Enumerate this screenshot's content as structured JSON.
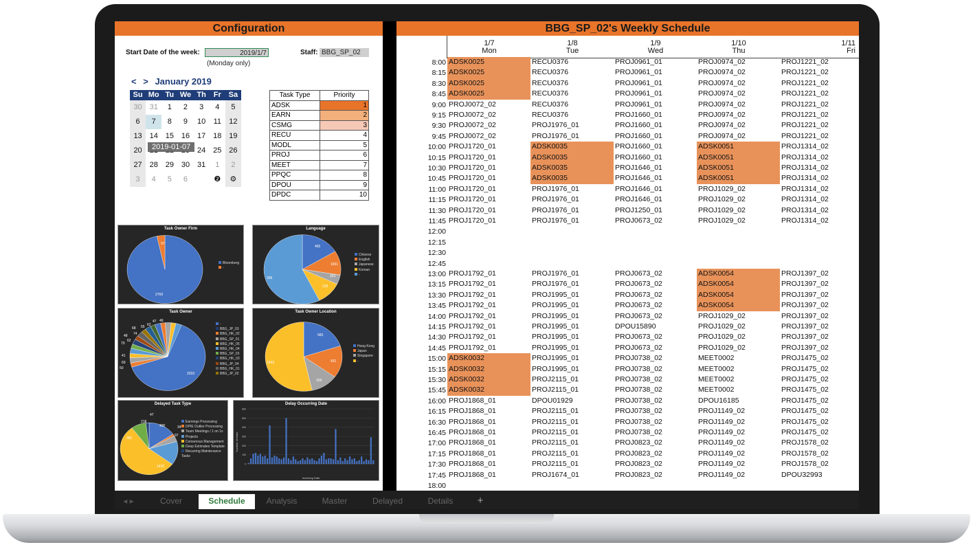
{
  "config": {
    "title": "Configuration",
    "start_label": "Start Date of the week:",
    "start_value": "2019/1/7",
    "monday_note": "(Monday only)",
    "staff_label": "Staff:",
    "staff_value": "BBG_SP_02",
    "calendar": {
      "prev": "<",
      "next": ">",
      "month": "January 2019",
      "dow": [
        "Su",
        "Mo",
        "Tu",
        "We",
        "Th",
        "Fr",
        "Sa"
      ],
      "tooltip": "2019-01-07"
    },
    "task_table": {
      "headers": [
        "Task Type",
        "Priority"
      ],
      "rows": [
        {
          "type": "ADSK",
          "priority": "1"
        },
        {
          "type": "EARN",
          "priority": "2"
        },
        {
          "type": "CSMG",
          "priority": "3"
        },
        {
          "type": "RECU",
          "priority": "4"
        },
        {
          "type": "MODL",
          "priority": "5"
        },
        {
          "type": "PROJ",
          "priority": "6"
        },
        {
          "type": "MEET",
          "priority": "7"
        },
        {
          "type": "PPQC",
          "priority": "8"
        },
        {
          "type": "DPOU",
          "priority": "9"
        },
        {
          "type": "DPDC",
          "priority": "10"
        }
      ]
    }
  },
  "charts": {
    "owner_firm": {
      "title": "Task Owner Firm",
      "labels": [
        "2769",
        "97"
      ],
      "legend": [
        "Bloomberg",
        "-"
      ]
    },
    "language": {
      "title": "Language",
      "labels": [
        "465",
        "1651",
        "323",
        "126",
        "306"
      ],
      "legend": [
        "Chinese",
        "English",
        "Japanese",
        "Korean",
        "-"
      ]
    },
    "task_owner": {
      "title": "Task Owner",
      "labels": [
        "2033",
        "68",
        "48",
        "74",
        "55",
        "62",
        "47",
        "49",
        "70",
        "62",
        "41",
        "69",
        "50"
      ],
      "legend": [
        "-",
        "BBG_JP_03",
        "BBG_HK_02",
        "BBG_SP_01",
        "BBG_HK_05",
        "BBG_HK_04",
        "BBG_SP_03",
        "BBG_HK_03",
        "BBG_JP_04",
        "BBG_HK_01",
        "BBG_JP_02"
      ]
    },
    "owner_location": {
      "title": "Task Owner Location",
      "labels": [
        "583",
        "431",
        "329",
        "1543"
      ],
      "legend": [
        "Hong Kong",
        "Japan",
        "Singapore",
        "-"
      ]
    },
    "delayed_type": {
      "title": "Delayed Task Type",
      "labels": [
        "400",
        "34",
        "97",
        "381",
        "1410",
        "218",
        "47"
      ],
      "legend": [
        "Earnings Processing",
        "DPIE Outlier Processing",
        "Team Meetings / 1 on 1s",
        "Projects",
        "Consensus Management",
        "Deep Estimates Template",
        "Recurring Maintenance Tasks"
      ]
    },
    "delay_date": {
      "title": "Delay Occurring Date",
      "xlabel": "Incoming Date",
      "ylabel": "Number of tasks",
      "yticks": [
        "600",
        "500",
        "400",
        "300",
        "200",
        "100",
        "0"
      ]
    }
  },
  "schedule": {
    "title": "BBG_SP_02's Weekly Schedule",
    "days": [
      {
        "date": "1/7",
        "dow": "Mon"
      },
      {
        "date": "1/8",
        "dow": "Tue"
      },
      {
        "date": "1/9",
        "dow": "Wed"
      },
      {
        "date": "1/10",
        "dow": "Thu"
      },
      {
        "date": "1/11",
        "dow": "Fri"
      }
    ],
    "rows": [
      {
        "t": "8:00",
        "c": [
          "ADSK0025*",
          "RECU0376",
          "PROJ0961_01",
          "PROJ0974_02",
          "PROJ1221_02"
        ]
      },
      {
        "t": "8:15",
        "c": [
          "ADSK0025*",
          "RECU0376",
          "PROJ0961_01",
          "PROJ0974_02",
          "PROJ1221_02"
        ]
      },
      {
        "t": "8:30",
        "c": [
          "ADSK0025*",
          "RECU0376",
          "PROJ0961_01",
          "PROJ0974_02",
          "PROJ1221_02"
        ]
      },
      {
        "t": "8:45",
        "c": [
          "ADSK0025*",
          "RECU0376",
          "PROJ0961_01",
          "PROJ0974_02",
          "PROJ1221_02"
        ]
      },
      {
        "t": "9:00",
        "c": [
          "PROJ0072_02",
          "RECU0376",
          "PROJ0961_01",
          "PROJ0974_02",
          "PROJ1221_02"
        ]
      },
      {
        "t": "9:15",
        "c": [
          "PROJ0072_02",
          "RECU0376",
          "PROJ1660_01",
          "PROJ0974_02",
          "PROJ1221_02"
        ]
      },
      {
        "t": "9:30",
        "c": [
          "PROJ0072_02",
          "PROJ1976_01",
          "PROJ1660_01",
          "PROJ0974_02",
          "PROJ1221_02"
        ]
      },
      {
        "t": "9:45",
        "c": [
          "PROJ0072_02",
          "PROJ1976_01",
          "PROJ1660_01",
          "PROJ0974_02",
          "PROJ1221_02"
        ]
      },
      {
        "t": "10:00",
        "c": [
          "PROJ1720_01",
          "ADSK0035*",
          "PROJ1660_01",
          "ADSK0051*",
          "PROJ1314_02"
        ]
      },
      {
        "t": "10:15",
        "c": [
          "PROJ1720_01",
          "ADSK0035*",
          "PROJ1660_01",
          "ADSK0051*",
          "PROJ1314_02"
        ]
      },
      {
        "t": "10:30",
        "c": [
          "PROJ1720_01",
          "ADSK0035*",
          "PROJ1646_01",
          "ADSK0051*",
          "PROJ1314_02"
        ]
      },
      {
        "t": "10:45",
        "c": [
          "PROJ1720_01",
          "ADSK0035*",
          "PROJ1646_01",
          "ADSK0051*",
          "PROJ1314_02"
        ]
      },
      {
        "t": "11:00",
        "c": [
          "PROJ1720_01",
          "PROJ1976_01",
          "PROJ1646_01",
          "PROJ1029_02",
          "PROJ1314_02"
        ]
      },
      {
        "t": "11:15",
        "c": [
          "PROJ1720_01",
          "PROJ1976_01",
          "PROJ1646_01",
          "PROJ1029_02",
          "PROJ1314_02"
        ]
      },
      {
        "t": "11:30",
        "c": [
          "PROJ1720_01",
          "PROJ1976_01",
          "PROJ1250_01",
          "PROJ1029_02",
          "PROJ1314_02"
        ]
      },
      {
        "t": "11:45",
        "c": [
          "PROJ1720_01",
          "PROJ1976_01",
          "PROJ0673_02",
          "PROJ1029_02",
          "PROJ1314_02"
        ]
      },
      {
        "t": "12:00",
        "c": [
          "",
          "",
          "",
          "",
          ""
        ]
      },
      {
        "t": "12:15",
        "c": [
          "",
          "",
          "",
          "",
          ""
        ]
      },
      {
        "t": "12:30",
        "c": [
          "",
          "",
          "",
          "",
          ""
        ]
      },
      {
        "t": "12:45",
        "c": [
          "",
          "",
          "",
          "",
          ""
        ]
      },
      {
        "t": "13:00",
        "c": [
          "PROJ1792_01",
          "PROJ1976_01",
          "PROJ0673_02",
          "ADSK0054*",
          "PROJ1397_02"
        ]
      },
      {
        "t": "13:15",
        "c": [
          "PROJ1792_01",
          "PROJ1976_01",
          "PROJ0673_02",
          "ADSK0054*",
          "PROJ1397_02"
        ]
      },
      {
        "t": "13:30",
        "c": [
          "PROJ1792_01",
          "PROJ1995_01",
          "PROJ0673_02",
          "ADSK0054*",
          "PROJ1397_02"
        ]
      },
      {
        "t": "13:45",
        "c": [
          "PROJ1792_01",
          "PROJ1995_01",
          "PROJ0673_02",
          "ADSK0054*",
          "PROJ1397_02"
        ]
      },
      {
        "t": "14:00",
        "c": [
          "PROJ1792_01",
          "PROJ1995_01",
          "PROJ0673_02",
          "PROJ1029_02",
          "PROJ1397_02"
        ]
      },
      {
        "t": "14:15",
        "c": [
          "PROJ1792_01",
          "PROJ1995_01",
          "DPOU15890",
          "PROJ1029_02",
          "PROJ1397_02"
        ]
      },
      {
        "t": "14:30",
        "c": [
          "PROJ1792_01",
          "PROJ1995_01",
          "PROJ0673_02",
          "PROJ1029_02",
          "PROJ1397_02"
        ]
      },
      {
        "t": "14:45",
        "c": [
          "PROJ1792_01",
          "PROJ1995_01",
          "PROJ0673_02",
          "PROJ1029_02",
          "PROJ1397_02"
        ]
      },
      {
        "t": "15:00",
        "c": [
          "ADSK0032*",
          "PROJ1995_01",
          "PROJ0738_02",
          "MEET0002",
          "PROJ1475_02"
        ]
      },
      {
        "t": "15:15",
        "c": [
          "ADSK0032*",
          "PROJ1995_01",
          "PROJ0738_02",
          "MEET0002",
          "PROJ1475_02"
        ]
      },
      {
        "t": "15:30",
        "c": [
          "ADSK0032*",
          "PROJ2115_01",
          "PROJ0738_02",
          "MEET0002",
          "PROJ1475_02"
        ]
      },
      {
        "t": "15:45",
        "c": [
          "ADSK0032*",
          "PROJ2115_01",
          "PROJ0738_02",
          "MEET0002",
          "PROJ1475_02"
        ]
      },
      {
        "t": "16:00",
        "c": [
          "PROJ1868_01",
          "DPOU01929",
          "PROJ0738_02",
          "DPOU16185",
          "PROJ1475_02"
        ]
      },
      {
        "t": "16:15",
        "c": [
          "PROJ1868_01",
          "PROJ2115_01",
          "PROJ0738_02",
          "PROJ1149_02",
          "PROJ1475_02"
        ]
      },
      {
        "t": "16:30",
        "c": [
          "PROJ1868_01",
          "PROJ2115_01",
          "PROJ0738_02",
          "PROJ1149_02",
          "PROJ1475_02"
        ]
      },
      {
        "t": "16:45",
        "c": [
          "PROJ1868_01",
          "PROJ2115_01",
          "PROJ0738_02",
          "PROJ1149_02",
          "PROJ1475_02"
        ]
      },
      {
        "t": "17:00",
        "c": [
          "PROJ1868_01",
          "PROJ2115_01",
          "PROJ0823_02",
          "PROJ1149_02",
          "PROJ1578_02"
        ]
      },
      {
        "t": "17:15",
        "c": [
          "PROJ1868_01",
          "PROJ2115_01",
          "PROJ0823_02",
          "PROJ1149_02",
          "PROJ1578_02"
        ]
      },
      {
        "t": "17:30",
        "c": [
          "PROJ1868_01",
          "PROJ2115_01",
          "PROJ0823_02",
          "PROJ1149_02",
          "PROJ1578_02"
        ]
      },
      {
        "t": "17:45",
        "c": [
          "PROJ1868_01",
          "PROJ1674_01",
          "PROJ0823_02",
          "PROJ1149_02",
          "DPOU32993"
        ]
      },
      {
        "t": "18:00",
        "c": [
          "",
          "",
          "",
          "",
          ""
        ]
      }
    ]
  },
  "tabs": [
    "Cover",
    "Schedule",
    "Analysis",
    "Master",
    "Delayed",
    "Details",
    "+"
  ],
  "colors": {
    "accent": "#e8742a",
    "highlight": "#e8925a",
    "calendar_header": "#1f3d78",
    "active_tab": "#2f7a3a"
  }
}
